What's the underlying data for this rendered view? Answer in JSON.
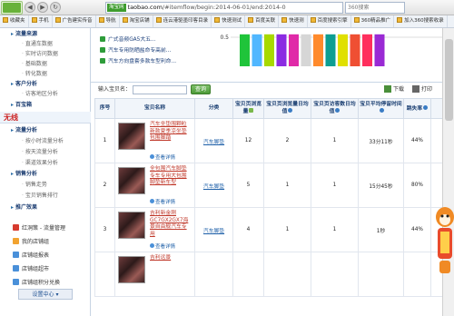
{
  "browser": {
    "nav": {
      "back": "◀",
      "forward": "▶",
      "refresh": "↻"
    },
    "site_badge": "淘宝网",
    "url_domain": "taobao.com",
    "url_path": "/#itemflow/begin:2014-06-01/end:2014-0",
    "search_placeholder": "360搜索",
    "bookmarks": [
      "收藏夹",
      "手机",
      "广告建实传音",
      "导航",
      "淘宝店铺",
      "连云港驱墨印客目录",
      "快速测试",
      "百度关联",
      "快速测",
      "百度搜索引擎",
      "360精品推广",
      "加入360搜索收录"
    ]
  },
  "sidebar": {
    "top_items": [
      "流量来源",
      "直通车数据",
      "实时访问数据",
      "基础数据",
      "转化数据"
    ],
    "customer_head": "客户分析",
    "customer_items": [
      "访客地区分析"
    ],
    "shop_head": "百宝箱",
    "wireless": "无线",
    "traffic_head": "流量分析",
    "traffic_items": [
      "按小时流量分析",
      "按天流量分析",
      "渠道效果分析"
    ],
    "sales_head": "销售分析",
    "sales_items": [
      "销售走势",
      "宝贝销售排行"
    ],
    "promo_head": "推广效果",
    "footer_links": [
      "红洞策 - 流量管理",
      "我的店铺组",
      "店铺组报表",
      "店铺组超市",
      "店铺组积分兑换"
    ],
    "setting": "设置中心 ▾"
  },
  "report_links": [
    "广式音频GA5大五...",
    "汽车专用防晒盐命专高前...",
    "汽车方向盘套多款车型利命..."
  ],
  "chart_data": {
    "type": "bar",
    "ylim": [
      0,
      0.5
    ],
    "y_tick": "0.5",
    "values": [
      0.55,
      0.55,
      0.55,
      0.55,
      0.55,
      0.55,
      0.55,
      0.55,
      0.55,
      0.55,
      0.55,
      0.55
    ],
    "colors": [
      "#1fc43a",
      "#50b7ff",
      "#a8d900",
      "#8b2be2",
      "#e02aa8",
      "#d6d6d6",
      "#ff8a2c",
      "#0d9e92",
      "#e0e000",
      "#ef4f33",
      "#ff2f5d",
      "#9a2ad4"
    ]
  },
  "toolbar": {
    "label": "输入宝贝名：",
    "input_value": "",
    "button": "查询",
    "download": "下载",
    "print": "打印"
  },
  "table": {
    "headers": {
      "no": "序号",
      "item": "宝贝名称",
      "category": "分类",
      "views": "宝贝页浏览量",
      "avg_views": "宝贝页浏览量日均值",
      "avg_visitors": "宝贝页访客数日均值",
      "avg_stay": "宝贝平均停留时间",
      "bounce": "跳失率"
    },
    "view_label": "查看详情",
    "rows": [
      {
        "no": "1",
        "name": "汽车坐垫围颗粒新款夏季凉坐垫包围脚踏",
        "category": "汽车脚垫",
        "views": "12",
        "avg_views": "2",
        "avg_visitors": "1",
        "avg_stay": "33分11秒",
        "bounce": "44%"
      },
      {
        "no": "2",
        "name": "全包围汽车脚垫专车专用大包围脚垫新车型",
        "category": "汽车脚垫",
        "views": "5",
        "avg_views": "1",
        "avg_visitors": "1",
        "avg_stay": "15分45秒",
        "bounce": "80%"
      },
      {
        "no": "3",
        "name": "吉利新金刚GC7GX2GX7海景自由舰汽车专用",
        "category": "汽车脚垫",
        "views": "4",
        "avg_views": "1",
        "avg_visitors": "1",
        "avg_stay": "1秒",
        "bounce": "44%"
      },
      {
        "no": "",
        "name": "吉利远景",
        "category": "",
        "views": "",
        "avg_views": "",
        "avg_visitors": "",
        "avg_stay": "",
        "bounce": ""
      }
    ]
  }
}
